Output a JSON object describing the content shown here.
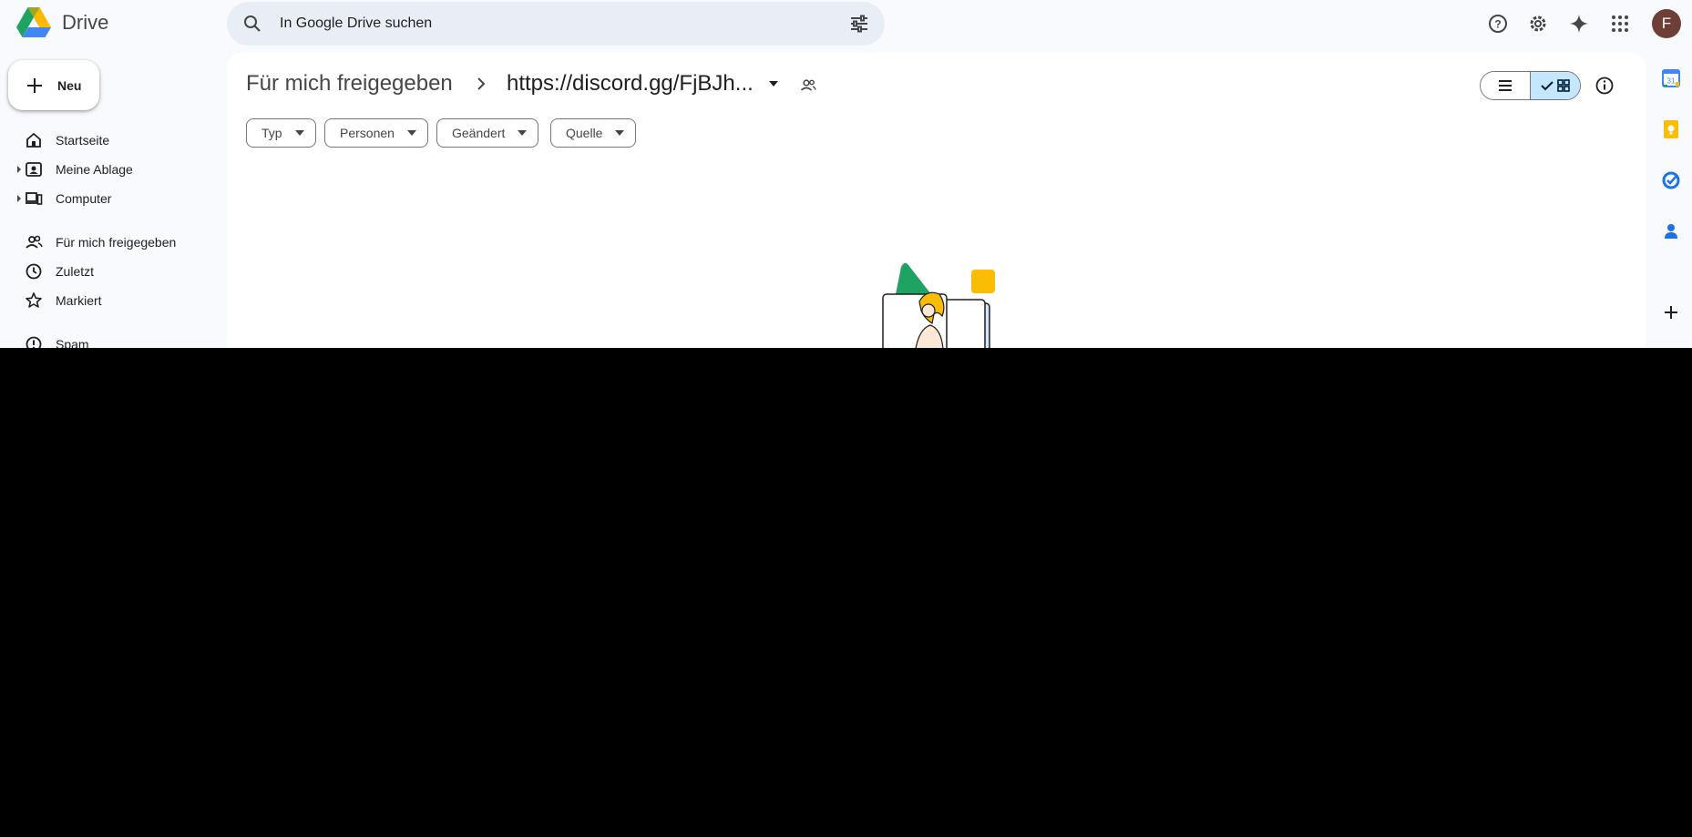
{
  "app": {
    "name": "Drive",
    "brand_colors": {
      "green": "#1ea362",
      "yellow": "#ffba00",
      "blue": "#4285f4",
      "red": "#ea4335"
    }
  },
  "search": {
    "placeholder": "In Google Drive suchen",
    "icon": "search-icon",
    "filter_icon": "tune-icon"
  },
  "header_icons": [
    "help-icon",
    "settings-icon",
    "gemini-sparkle-icon",
    "apps-grid-icon"
  ],
  "account": {
    "initial": "F",
    "color": "#6d3f36"
  },
  "sidebar": {
    "new_label": "Neu",
    "items": [
      {
        "label": "Startseite",
        "icon": "home-icon"
      },
      {
        "label": "Meine Ablage",
        "icon": "my-drive-icon",
        "expandable": true
      },
      {
        "label": "Computer",
        "icon": "computers-icon",
        "expandable": true
      },
      {
        "label": "Für mich freigegeben",
        "icon": "shared-icon"
      },
      {
        "label": "Zuletzt",
        "icon": "recent-icon"
      },
      {
        "label": "Markiert",
        "icon": "star-icon"
      },
      {
        "label": "Spam",
        "icon": "spam-icon"
      }
    ]
  },
  "breadcrumb": {
    "root": "Für mich freigegeben",
    "current": "https://discord.gg/FjBJh..."
  },
  "view": {
    "mode": "grid",
    "options": [
      "list",
      "grid"
    ]
  },
  "filters": [
    {
      "label": "Typ"
    },
    {
      "label": "Personen"
    },
    {
      "label": "Geändert"
    },
    {
      "label": "Quelle"
    }
  ],
  "right_rail": [
    "calendar-icon",
    "keep-icon",
    "tasks-icon",
    "contacts-icon",
    "add-icon"
  ]
}
